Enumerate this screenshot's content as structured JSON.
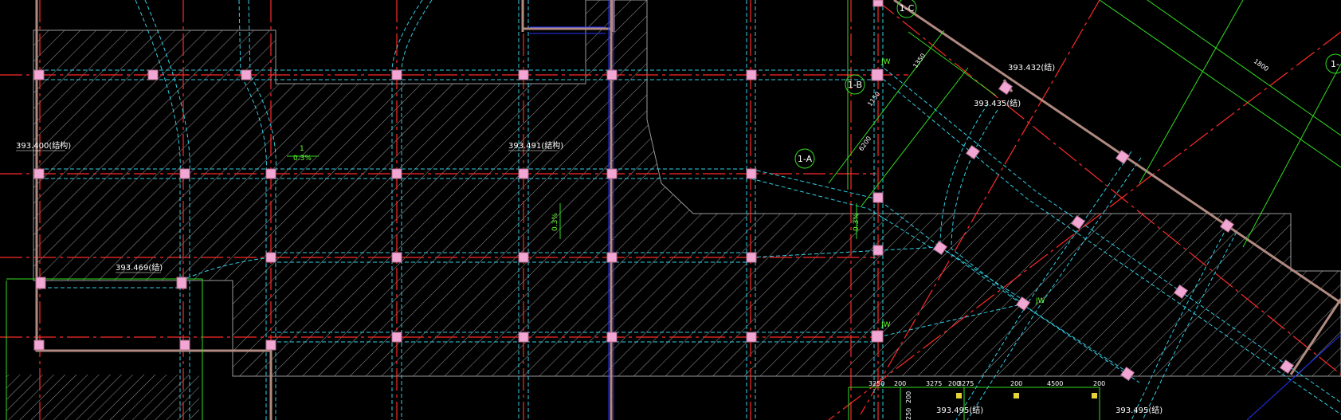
{
  "colors": {
    "background": "#000000",
    "axis_line": "#ff2a2a",
    "beam_line": "#2fd0e6",
    "wall": "#b08a80",
    "dimension": "#33dd22",
    "column": "#f2a6d4",
    "text": "#ffffff"
  },
  "axis_bubbles": {
    "a": "1-A",
    "b": "1-B",
    "c": "1-C",
    "edge": "1-"
  },
  "elevations": {
    "e1": "393.400(结构)",
    "e2": "393.491(结构)",
    "e3": "393.469(结)",
    "e4": "393.432(结)",
    "e5": "393.435(结)",
    "e6": "393.495(结)",
    "e7": "393.495(结)"
  },
  "dimensions": {
    "d1350": "1350",
    "d1150": "1150",
    "d6200": "6200",
    "d1800": "1800",
    "d3250": "3250",
    "d200a": "200",
    "d3275a": "3275",
    "d200b": "200",
    "d3275b": "3275",
    "d200c": "200",
    "d4500": "4500",
    "d200d": "200",
    "v200a": "200",
    "v250": "250"
  },
  "slope_marks": {
    "s1": "0.3%",
    "s2": "0.3%",
    "s3": "0.3%",
    "num": "1"
  },
  "column_marks": {
    "m1": "JW",
    "m2": "JW",
    "m3": "JW"
  }
}
